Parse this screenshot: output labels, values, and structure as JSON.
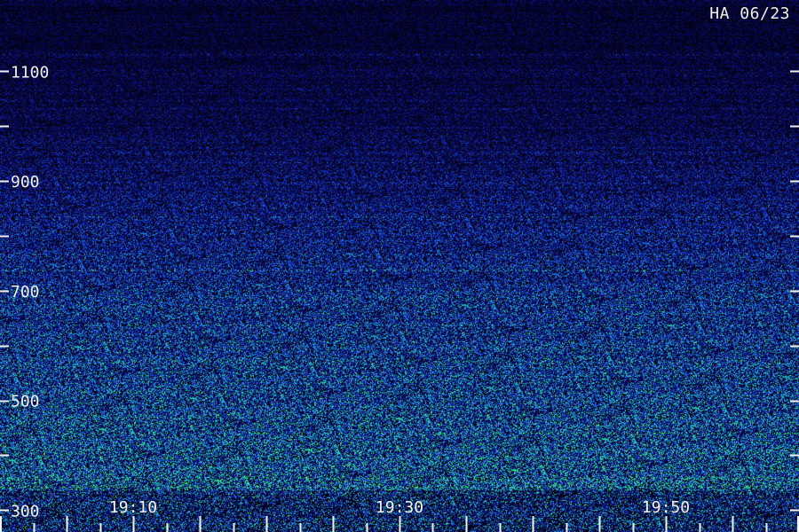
{
  "stamp": "HA 06/23",
  "colors": {
    "background": "#000000",
    "low": "#0a0a6e",
    "mid": "#1e50e6",
    "high": "#28e6b4",
    "peak": "#50ff50",
    "text": "#f2f2f2"
  },
  "chart_data": {
    "type": "heatmap",
    "title": "",
    "xlabel": "",
    "ylabel": "",
    "x_axis": {
      "range": [
        "19:00",
        "20:00"
      ],
      "tick_labels": [
        "19:10",
        "19:30",
        "19:50"
      ],
      "label_minutes": [
        10,
        30,
        50
      ],
      "major_tick_minutes": [
        0,
        5,
        10,
        15,
        20,
        25,
        30,
        35,
        40,
        45,
        50,
        55,
        60
      ],
      "minor_tick_minutes": [
        2.5,
        7.5,
        12.5,
        17.5,
        22.5,
        27.5,
        32.5,
        37.5,
        42.5,
        47.5,
        52.5,
        57.5
      ]
    },
    "y_axis": {
      "range": [
        260,
        1230
      ],
      "tick_labels": [
        "300",
        "500",
        "700",
        "900",
        "1100"
      ],
      "label_values": [
        300,
        500,
        700,
        900,
        1100
      ],
      "tick_values": [
        300,
        400,
        500,
        600,
        700,
        800,
        900,
        1000,
        1100
      ]
    },
    "intensity_profile": {
      "y": [
        300,
        400,
        500,
        600,
        700,
        800,
        900,
        1000,
        1100,
        1200
      ],
      "level": [
        0.8,
        0.78,
        0.72,
        0.68,
        0.62,
        0.55,
        0.45,
        0.36,
        0.3,
        0.24
      ]
    },
    "grid": false,
    "legend": "none"
  }
}
